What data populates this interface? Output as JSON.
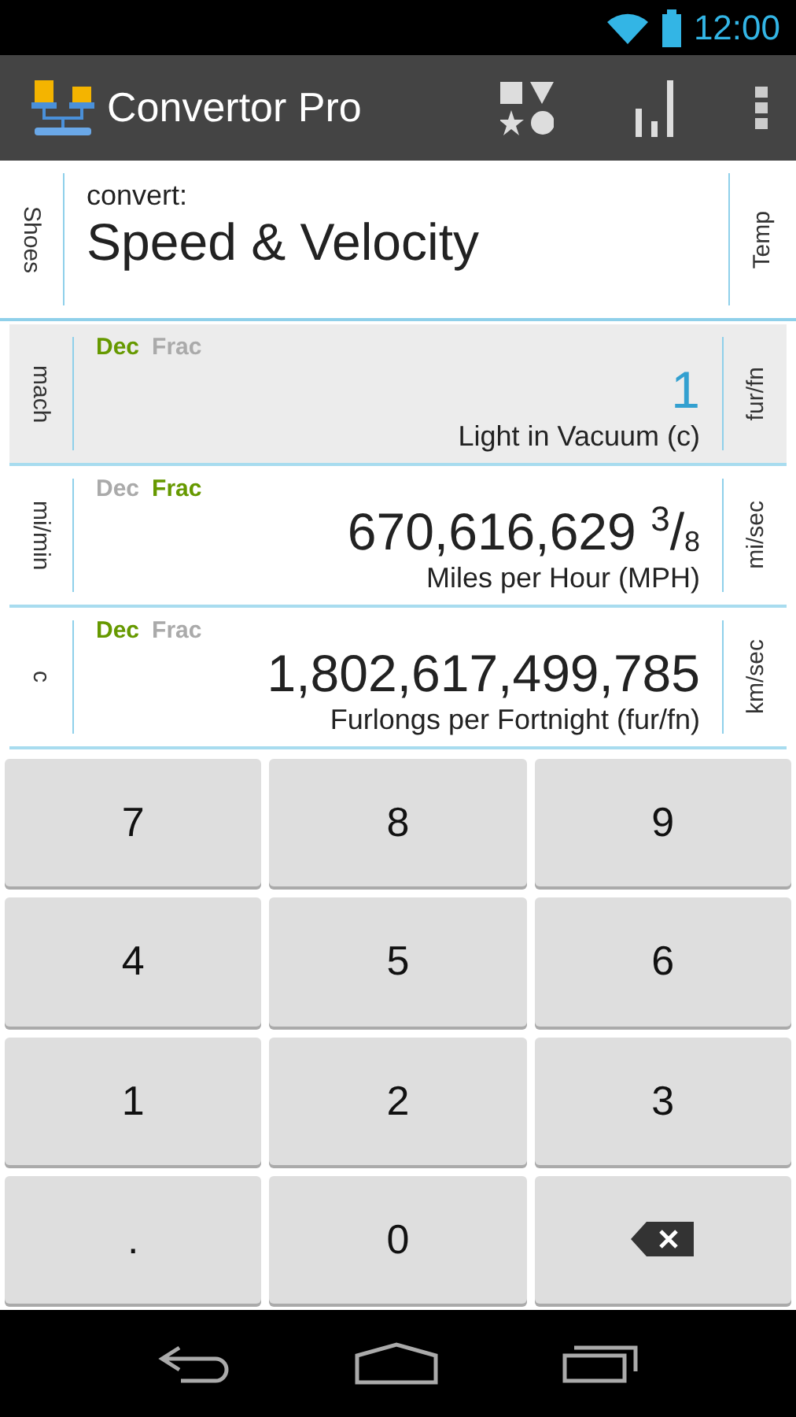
{
  "status_bar": {
    "time": "12:00"
  },
  "action_bar": {
    "title": "Convertor Pro"
  },
  "header": {
    "left_tab": "Shoes",
    "caption": "convert:",
    "category": "Speed & Velocity",
    "right_tab": "Temp"
  },
  "rows": [
    {
      "left_tab": "mach",
      "right_tab": "fur/fn",
      "selected": true,
      "formats": [
        {
          "label": "Dec",
          "selected": true
        },
        {
          "label": "Frac",
          "selected": false
        }
      ],
      "value": "1",
      "unit": "Light in Vacuum (c)"
    },
    {
      "left_tab": "mi/min",
      "right_tab": "mi/sec",
      "selected": false,
      "formats": [
        {
          "label": "Dec",
          "selected": false
        },
        {
          "label": "Frac",
          "selected": true
        }
      ],
      "value": "670,616,629 $^{3}$/$_{8}$",
      "unit": "Miles per Hour (MPH)"
    },
    {
      "left_tab": "c",
      "right_tab": "km/sec",
      "selected": false,
      "formats": [
        {
          "label": "Dec",
          "selected": true
        },
        {
          "label": "Frac",
          "selected": false
        }
      ],
      "value": "1,802,617,499,785",
      "unit": "Furlongs per Fortnight (fur/fn)"
    }
  ],
  "keypad": [
    {
      "kind": "digit",
      "label": "7"
    },
    {
      "kind": "digit",
      "label": "8"
    },
    {
      "kind": "digit",
      "label": "9"
    },
    {
      "kind": "digit",
      "label": "4"
    },
    {
      "kind": "digit",
      "label": "5"
    },
    {
      "kind": "digit",
      "label": "6"
    },
    {
      "kind": "digit",
      "label": "1"
    },
    {
      "kind": "digit",
      "label": "2"
    },
    {
      "kind": "digit",
      "label": "3"
    },
    {
      "kind": "digit",
      "label": "."
    },
    {
      "kind": "digit",
      "label": "0"
    },
    {
      "kind": "backspace"
    }
  ]
}
